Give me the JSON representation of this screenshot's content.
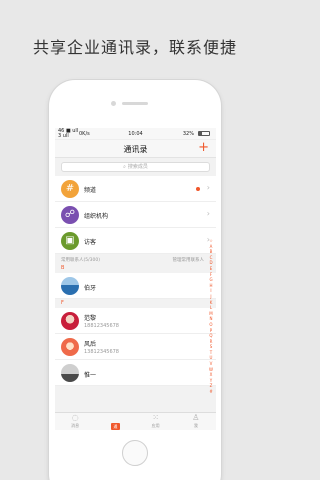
{
  "headline": "共享企业通讯录，联系便捷",
  "status_bar": {
    "carrier_line1": "46 ■ ull",
    "carrier_line2": "3 ull",
    "network": "0K/s",
    "time": "10:04",
    "battery": "32%"
  },
  "nav": {
    "title": "通讯录",
    "add_symbol": "+"
  },
  "search": {
    "placeholder": "搜索成员"
  },
  "menu_items": [
    {
      "label": "频道",
      "icon": "hash-icon",
      "glyph": "#",
      "color": "#f2a33a",
      "has_dot": true
    },
    {
      "label": "组织机构",
      "icon": "org-icon",
      "glyph": "☍",
      "color": "#7a4fb0",
      "has_dot": false
    },
    {
      "label": "访客",
      "icon": "visitor-icon",
      "glyph": "▣",
      "color": "#6b9a2c",
      "has_dot": false
    }
  ],
  "section": {
    "left": "常用联系人(5/300)",
    "right": "管理常用联系人"
  },
  "groups": [
    {
      "letter": "B",
      "contacts": [
        {
          "name": "伯牙",
          "phone": ""
        }
      ]
    },
    {
      "letter": "F",
      "contacts": [
        {
          "name": "范黎",
          "phone": "18812345678"
        },
        {
          "name": "风后",
          "phone": "13812345678"
        },
        {
          "name": "惟一",
          "phone": ""
        }
      ]
    }
  ],
  "index_letters": [
    "☆",
    "A",
    "B",
    "C",
    "D",
    "E",
    "F",
    "G",
    "H",
    "I",
    "J",
    "K",
    "L",
    "M",
    "N",
    "O",
    "P",
    "Q",
    "R",
    "S",
    "T",
    "U",
    "V",
    "W",
    "X",
    "Y",
    "Z",
    "#"
  ],
  "tabs": [
    {
      "label": "消息",
      "icon": "message-icon",
      "glyph": "◌",
      "active": false
    },
    {
      "label": "通讯录",
      "icon": "contacts-icon",
      "glyph": "通",
      "active": true
    },
    {
      "label": "应用",
      "icon": "apps-icon",
      "glyph": "⁙",
      "active": false
    },
    {
      "label": "我",
      "icon": "person-icon",
      "glyph": "♙",
      "active": false
    }
  ],
  "colors": {
    "accent": "#f0572b"
  }
}
